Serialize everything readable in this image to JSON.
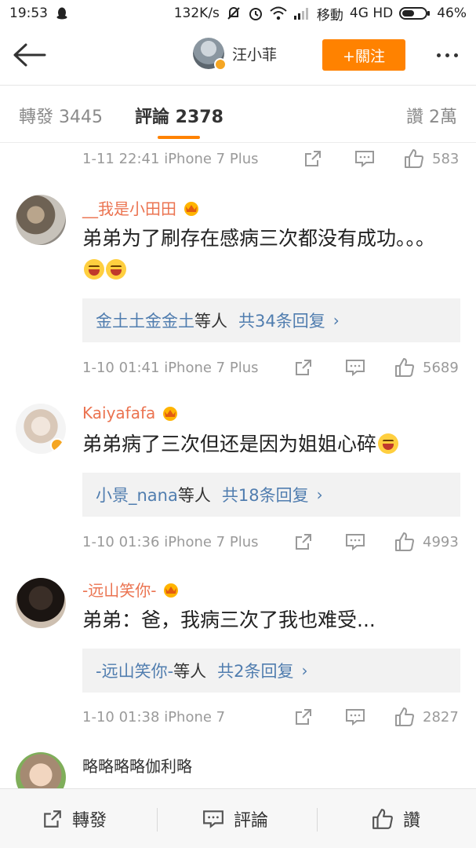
{
  "status_bar": {
    "time": "19:53",
    "network_speed": "132K/s",
    "carrier": "移動",
    "network": "4G HD",
    "battery": "46%"
  },
  "header": {
    "username": "汪小菲",
    "follow_label": "+關注"
  },
  "tabs": [
    {
      "label": "轉發 3445"
    },
    {
      "label": "評論 2378"
    },
    {
      "label": "讚 2萬"
    }
  ],
  "colors": {
    "accent": "#ff8200",
    "link": "#507daf",
    "username": "#eb7350"
  },
  "first_meta": {
    "time": "1-11 22:41",
    "device": "iPhone 7 Plus",
    "likes": "583"
  },
  "comments": [
    {
      "name": "__我是小田田",
      "text": "弟弟为了刷存在感病三次都没有成功。。。",
      "emoji_count": 2,
      "reply_user": "金土土金金土",
      "reply_mid": "等人",
      "reply_count": "共34条回复",
      "time": "1-10 01:41",
      "device": "iPhone 7 Plus",
      "likes": "5689"
    },
    {
      "name": "Kaiyafafa",
      "text": "弟弟病了三次但还是因为姐姐心碎",
      "emoji_count": 1,
      "reply_user": "小景_nana",
      "reply_mid": "等人",
      "reply_count": "共18条回复",
      "time": "1-10 01:36",
      "device": "iPhone 7 Plus",
      "likes": "4993"
    },
    {
      "name": "-远山笑你-",
      "text": "弟弟：爸，我病三次了我也难受...",
      "emoji_count": 0,
      "reply_user": "-远山笑你-",
      "reply_mid": "等人",
      "reply_count": "共2条回复",
      "time": "1-10 01:38",
      "device": "iPhone 7",
      "likes": "2827"
    },
    {
      "name": "略略略略伽利略"
    }
  ],
  "bottom_bar": {
    "repost": "轉發",
    "comment": "評論",
    "like": "讚"
  }
}
